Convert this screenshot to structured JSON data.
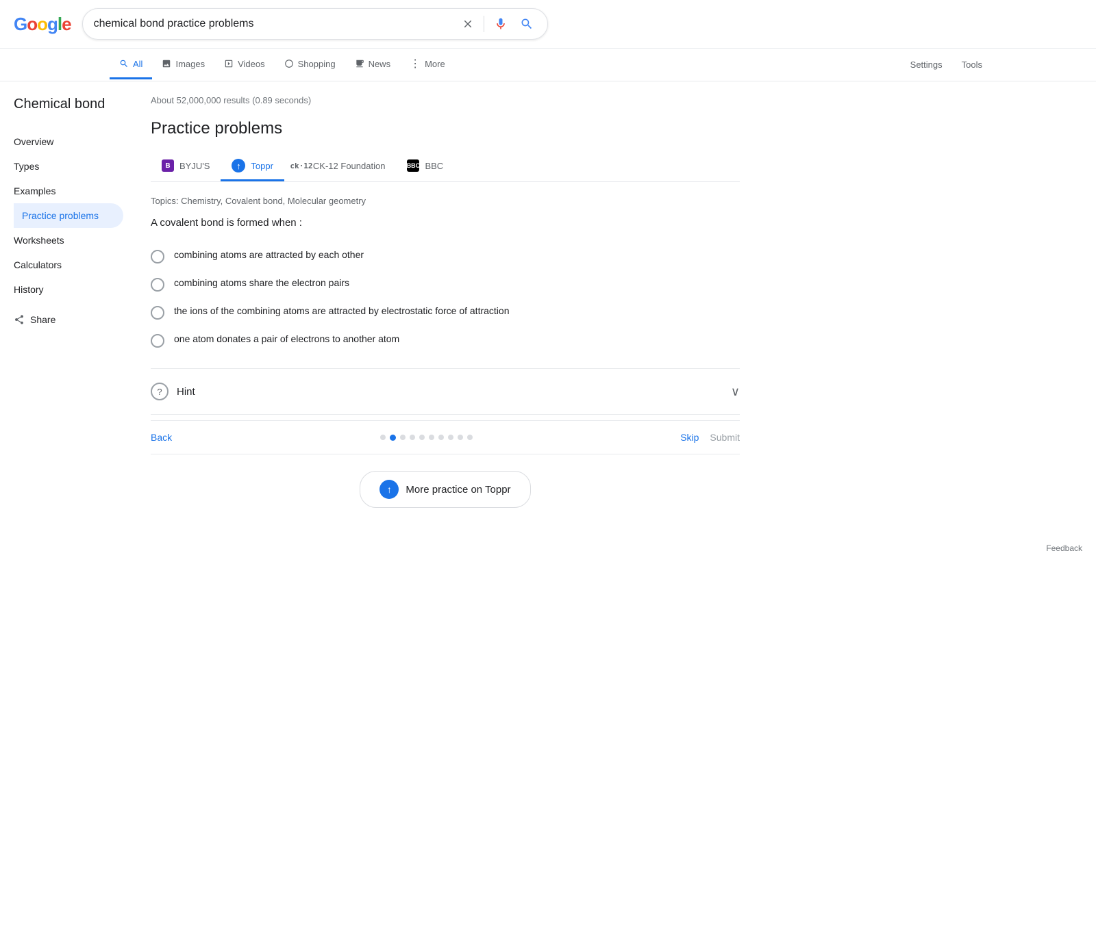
{
  "header": {
    "logo": {
      "g1": "G",
      "o1": "o",
      "o2": "o",
      "g2": "g",
      "l": "l",
      "e": "e"
    },
    "search_query": "chemical bond practice problems",
    "clear_icon": "×",
    "mic_icon": "🎤",
    "search_icon": "🔍"
  },
  "nav": {
    "tabs": [
      {
        "id": "all",
        "label": "All",
        "icon": "🔍",
        "active": true
      },
      {
        "id": "images",
        "label": "Images",
        "icon": "🖼"
      },
      {
        "id": "videos",
        "label": "Videos",
        "icon": "▶"
      },
      {
        "id": "shopping",
        "label": "Shopping",
        "icon": "◇"
      },
      {
        "id": "news",
        "label": "News",
        "icon": "📰"
      },
      {
        "id": "more",
        "label": "More",
        "icon": "⋮"
      }
    ],
    "settings": "Settings",
    "tools": "Tools"
  },
  "results_count": "About 52,000,000 results (0.89 seconds)",
  "sidebar": {
    "title": "Chemical bond",
    "items": [
      {
        "id": "overview",
        "label": "Overview",
        "active": false
      },
      {
        "id": "types",
        "label": "Types",
        "active": false
      },
      {
        "id": "examples",
        "label": "Examples",
        "active": false
      },
      {
        "id": "practice",
        "label": "Practice problems",
        "active": true
      },
      {
        "id": "worksheets",
        "label": "Worksheets",
        "active": false
      },
      {
        "id": "calculators",
        "label": "Calculators",
        "active": false
      },
      {
        "id": "history",
        "label": "History",
        "active": false
      }
    ],
    "share_label": "Share"
  },
  "main": {
    "section_title": "Practice problems",
    "sources": [
      {
        "id": "byjus",
        "label": "BYJU'S",
        "icon_text": "B",
        "active": false
      },
      {
        "id": "toppr",
        "label": "Toppr",
        "icon_text": "↑",
        "active": true
      },
      {
        "id": "ck12",
        "label": "CK-12 Foundation",
        "icon_text": "ck·12",
        "active": false
      },
      {
        "id": "bbc",
        "label": "BBC",
        "icon_text": "BBC",
        "active": false
      }
    ],
    "topics": "Topics: Chemistry, Covalent bond, Molecular geometry",
    "question": "A covalent bond is formed when :",
    "options": [
      {
        "id": "a",
        "text": "combining atoms are attracted by each other"
      },
      {
        "id": "b",
        "text": "combining atoms share the electron pairs"
      },
      {
        "id": "c",
        "text": "the ions of the combining atoms are attracted by electrostatic force of attraction"
      },
      {
        "id": "d",
        "text": "one atom donates a pair of electrons to another atom"
      }
    ],
    "hint_label": "Hint",
    "back_label": "Back",
    "skip_label": "Skip",
    "submit_label": "Submit",
    "dots_count": 10,
    "active_dot": 1,
    "more_practice_label": "More practice on Toppr",
    "feedback_label": "Feedback"
  }
}
